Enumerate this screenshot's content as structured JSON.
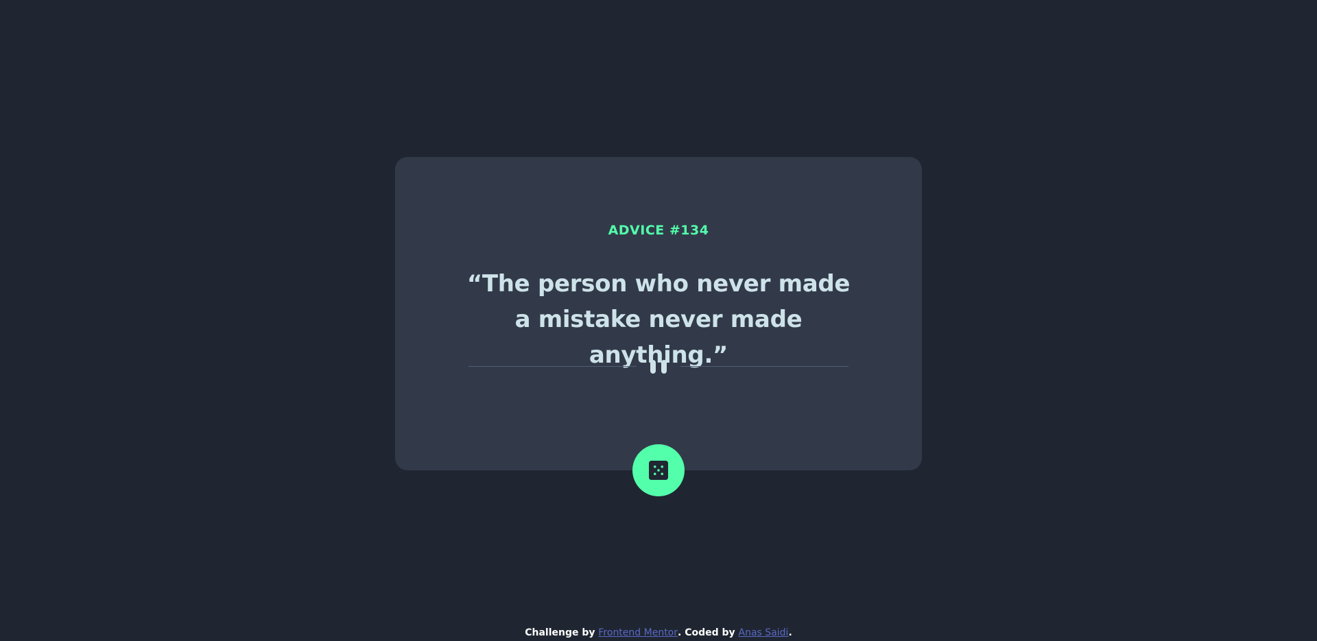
{
  "advice": {
    "label": "ADVICE #134",
    "text": "“The person who never made a mistake never made anything.”"
  },
  "divider": {
    "icon": "pause-icon"
  },
  "button": {
    "icon": "dice-icon"
  },
  "footer": {
    "prefix": "Challenge by ",
    "link1": "Frontend Mentor",
    "middle": ". Coded by ",
    "link2": "Anas Saidi",
    "suffix": "."
  },
  "colors": {
    "background": "#1f2631",
    "card": "#323a4a",
    "accent": "#53ffaa",
    "text": "#cee3e9",
    "link": "#5a68c6"
  }
}
